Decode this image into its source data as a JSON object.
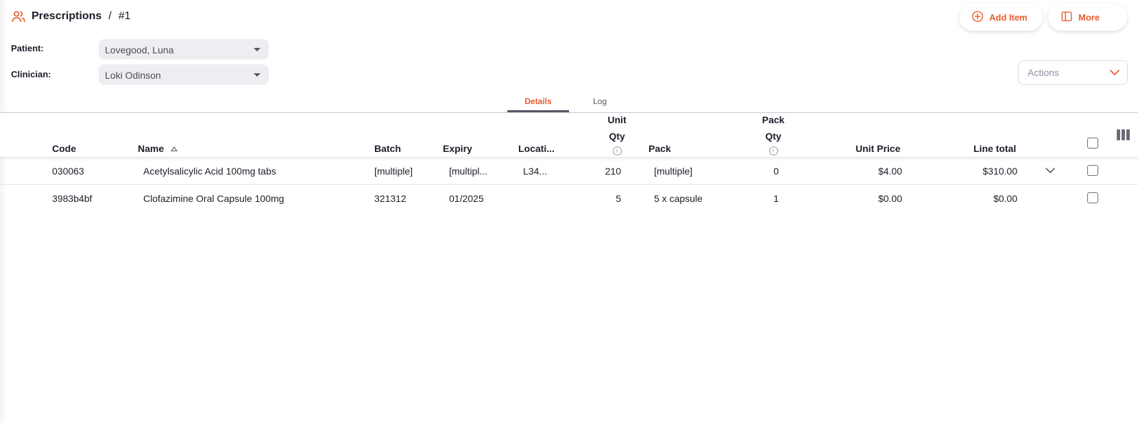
{
  "breadcrumb": {
    "title": "Prescriptions",
    "separator": "/",
    "id": "#1"
  },
  "toolbar": {
    "add_item_label": "Add Item",
    "more_label": "More"
  },
  "fields": {
    "patient_label": "Patient:",
    "patient_value": "Lovegood, Luna",
    "clinician_label": "Clinician:",
    "clinician_value": "Loki Odinson"
  },
  "actions": {
    "placeholder": "Actions"
  },
  "tabs": [
    {
      "label": "Details",
      "active": true
    },
    {
      "label": "Log",
      "active": false
    }
  ],
  "table": {
    "columns": {
      "code": "Code",
      "name": "Name",
      "batch": "Batch",
      "expiry": "Expiry",
      "location": "Locati...",
      "unit_qty_1": "Unit",
      "unit_qty_2": "Qty",
      "pack": "Pack",
      "pack_qty_1": "Pack",
      "pack_qty_2": "Qty",
      "unit_price": "Unit Price",
      "line_total": "Line total"
    },
    "rows": [
      {
        "code": "030063",
        "name": "Acetylsalicylic Acid 100mg tabs",
        "batch": "[multiple]",
        "expiry": "[multipl...",
        "location": "L34...",
        "unit_qty": "210",
        "pack": "[multiple]",
        "pack_qty": "0",
        "unit_price": "$4.00",
        "line_total": "$310.00"
      },
      {
        "code": "3983b4bf",
        "name": "Clofazimine Oral Capsule 100mg",
        "batch": "321312",
        "expiry": "01/2025",
        "location": "",
        "unit_qty": "5",
        "pack": "5 x capsule",
        "pack_qty": "1",
        "unit_price": "$0.00",
        "line_total": "$0.00"
      }
    ]
  },
  "colors": {
    "accent": "#e95c30",
    "text": "#1c1c28",
    "select_bg": "#eeeef2"
  },
  "icons": {
    "breadcrumb": "users-icon",
    "add_item": "plus-circle-icon",
    "more": "sidebar-panel-icon",
    "actions_caret": "chevron-down-icon",
    "sort": "sort-ascending-icon",
    "info": "info-icon",
    "columns": "columns-icon",
    "row_expand": "chevron-down-icon"
  }
}
